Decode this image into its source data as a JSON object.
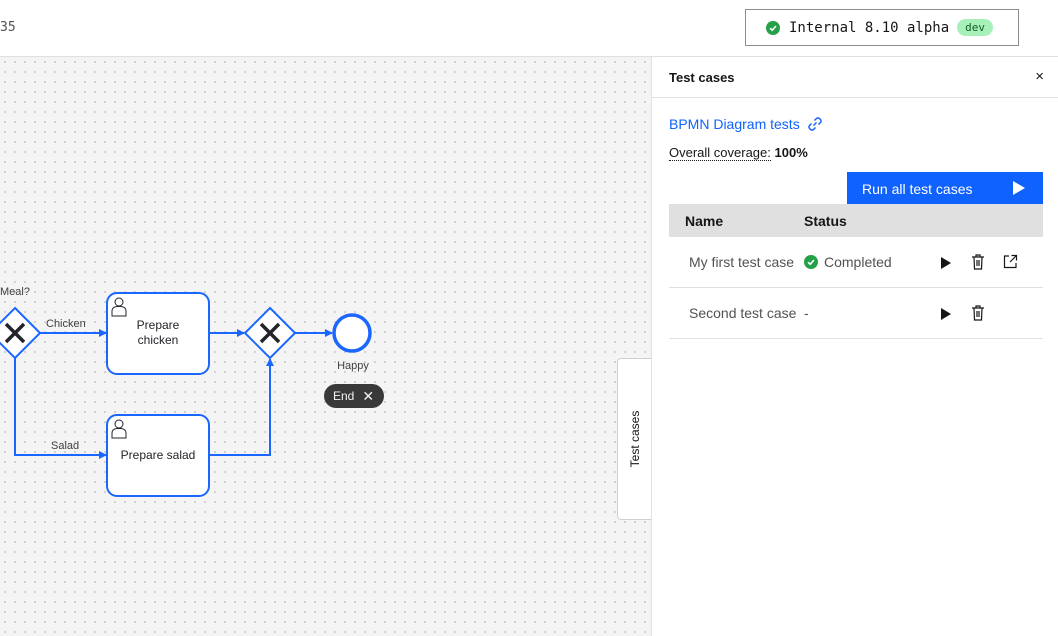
{
  "topbar": {
    "partial_text": "35",
    "version": "Internal 8.10 alpha",
    "version_tag": "dev"
  },
  "diagram": {
    "gateway_question": "Meal?",
    "flow_chicken": "Chicken",
    "flow_salad": "Salad",
    "task_chicken_line1": "Prepare",
    "task_chicken_line2": "chicken",
    "task_salad": "Prepare salad",
    "end_event_label": "Happy",
    "end_badge": "End",
    "end_badge_close": "✕"
  },
  "side_tab": {
    "label": "Test cases"
  },
  "panel": {
    "title": "Test cases",
    "close": "×",
    "suite_link": "BPMN Diagram tests",
    "coverage_label": "Overall coverage:",
    "coverage_value": "100%",
    "run_all": "Run all test cases",
    "columns": [
      "Name",
      "Status"
    ],
    "rows": [
      {
        "name": "My first test case",
        "status": "Completed"
      },
      {
        "name": "Second test case",
        "status": "-"
      }
    ]
  },
  "colors": {
    "accent": "#0f62fe",
    "success": "#24a148",
    "bpmn_stroke": "#1a66ff"
  },
  "icons": [
    "check-circle-icon",
    "link-icon",
    "play-icon",
    "trash-icon",
    "open-external-icon",
    "close-icon",
    "user-task-icon",
    "exclusive-gateway-icon"
  ]
}
